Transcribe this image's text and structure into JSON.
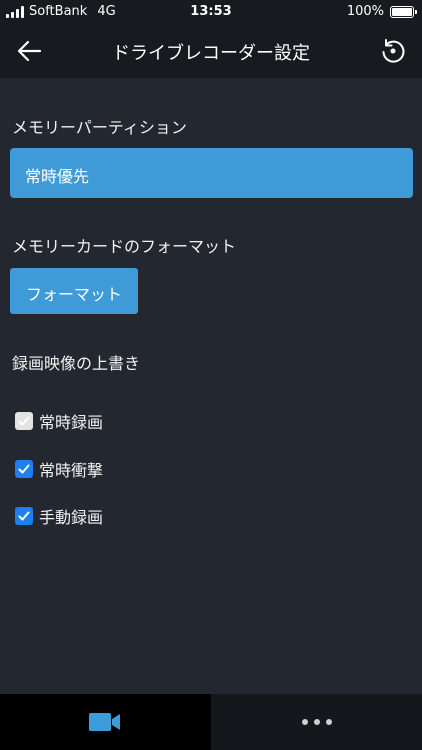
{
  "status_bar": {
    "carrier": "SoftBank",
    "network": "4G",
    "time": "13:53",
    "battery": "100%"
  },
  "nav": {
    "title": "ドライブレコーダー設定",
    "back_icon": "arrow-left-icon",
    "reset_icon": "reset-icon"
  },
  "partition": {
    "label": "メモリーパーティション",
    "value": "常時優先"
  },
  "format": {
    "label": "メモリーカードのフォーマット",
    "button": "フォーマット"
  },
  "overwrite": {
    "label": "録画映像の上書き",
    "options": [
      {
        "label": "常時録画",
        "checked": true,
        "disabled": true
      },
      {
        "label": "常時衝撃",
        "checked": true,
        "disabled": false
      },
      {
        "label": "手動録画",
        "checked": true,
        "disabled": false
      }
    ]
  },
  "tabs": [
    {
      "icon": "video-camera-icon",
      "color": "#3e9bd8"
    },
    {
      "icon": "more-dots-icon",
      "color": "#d0d0d0"
    }
  ]
}
